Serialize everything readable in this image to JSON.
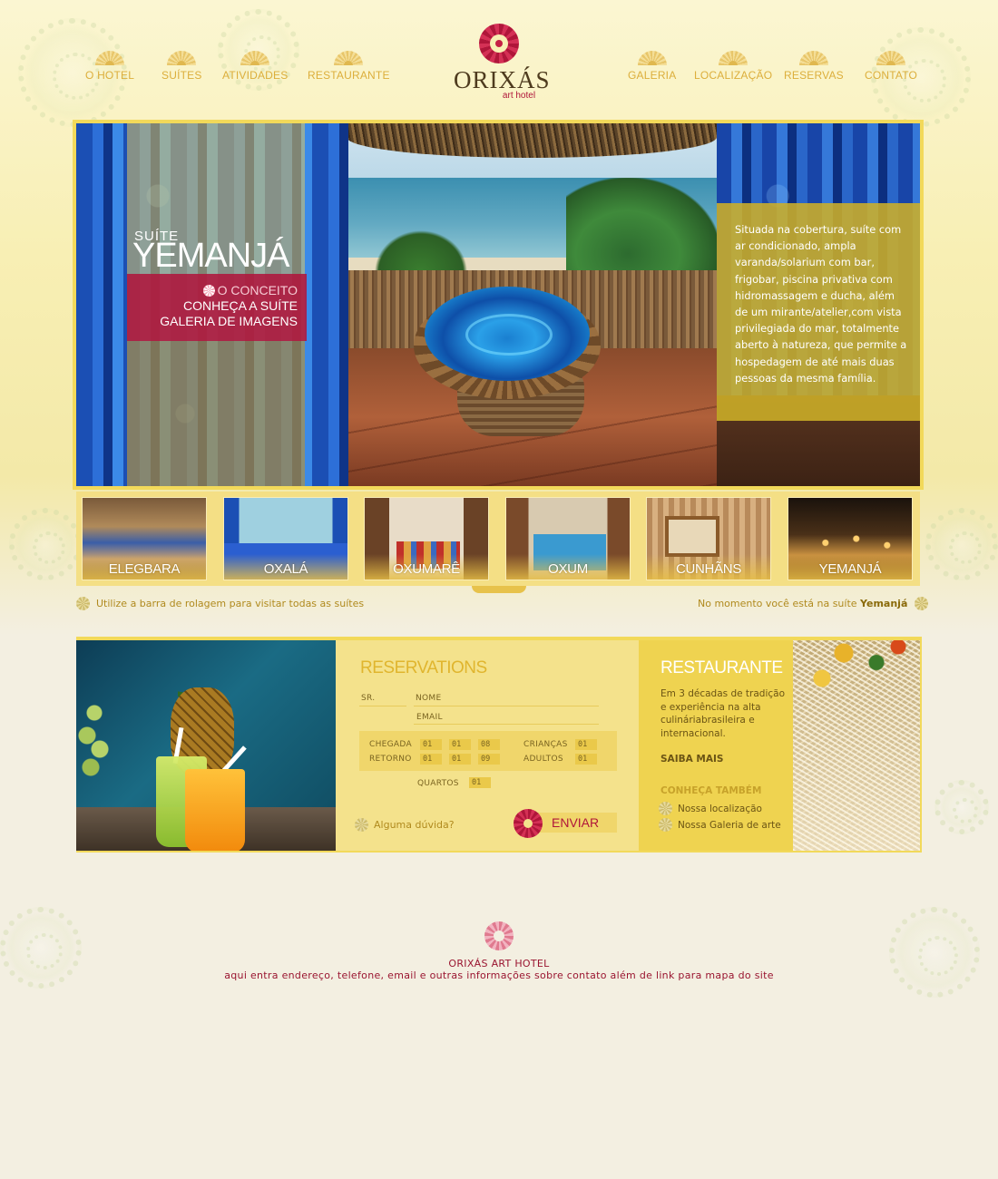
{
  "nav": {
    "left": [
      {
        "label": "O HOTEL"
      },
      {
        "label": "SUÍTES"
      },
      {
        "label": "ATIVIDADES"
      },
      {
        "label": "RESTAURANTE"
      }
    ],
    "right": [
      {
        "label": "GALERIA"
      },
      {
        "label": "LOCALIZAÇÃO"
      },
      {
        "label": "RESERVAS"
      },
      {
        "label": "CONTATO"
      }
    ]
  },
  "logo": {
    "name": "ORIXÁS",
    "sub": "art hotel"
  },
  "hero": {
    "suite_prefix": "SUÍTE",
    "suite_name": "YEMANJÁ",
    "menu": [
      "O CONCEITO",
      "CONHEÇA A SUÍTE",
      "GALERIA DE IMAGENS"
    ],
    "description": "Situada na cobertura, suíte com ar condicionado, ampla varanda/solarium com bar, frigobar, piscina privativa com hidromassagem e ducha, além de um mirante/atelier,com vista privilegiada do mar, totalmente aberto à natureza, que permite a hospedagem de até mais duas pessoas da mesma família."
  },
  "suites": [
    {
      "label": "ELEGBARA"
    },
    {
      "label": "OXALÁ"
    },
    {
      "label": "OXUMARÊ"
    },
    {
      "label": "OXUM"
    },
    {
      "label": "CUNHÃNS"
    },
    {
      "label": "YEMANJÁ"
    }
  ],
  "hints": {
    "left": "Utilize a barra de rolagem para visitar todas as suítes",
    "right_prefix": "No momento você está na suíte ",
    "right_suite": "Yemanjá"
  },
  "reservations": {
    "title": "RESERVATIONS",
    "labels": {
      "sr": "SR.",
      "nome": "NOME",
      "email": "EMAIL",
      "chegada": "CHEGADA",
      "retorno": "RETORNO",
      "criancas": "CRIANÇAS",
      "adultos": "ADULTOS",
      "quartos": "QUARTOS"
    },
    "values": {
      "chegada": [
        "01",
        "01",
        "08"
      ],
      "retorno": [
        "01",
        "01",
        "09"
      ],
      "criancas": "01",
      "adultos": "01",
      "quartos": "01"
    },
    "question": "Alguma dúvida?",
    "send": "ENVIAR"
  },
  "restaurant": {
    "title": "RESTAURANTE",
    "text": "Em 3 décadas de tradição e experiência na alta culináriabrasileira e internacional.",
    "more": "SAIBA MAIS",
    "subtitle": "CONHEÇA TAMBÉM",
    "links": [
      "Nossa localização",
      "Nossa Galeria de arte"
    ]
  },
  "footer": {
    "name": "ORIXÁS ART HOTEL",
    "info": "aqui entra endereço, telefone, email e outras informações sobre contato além de link para mapa do site"
  },
  "colors": {
    "accent_gold": "#dcae3b",
    "brand_red": "#b0163a",
    "panel_yellow": "#f2d95a"
  }
}
